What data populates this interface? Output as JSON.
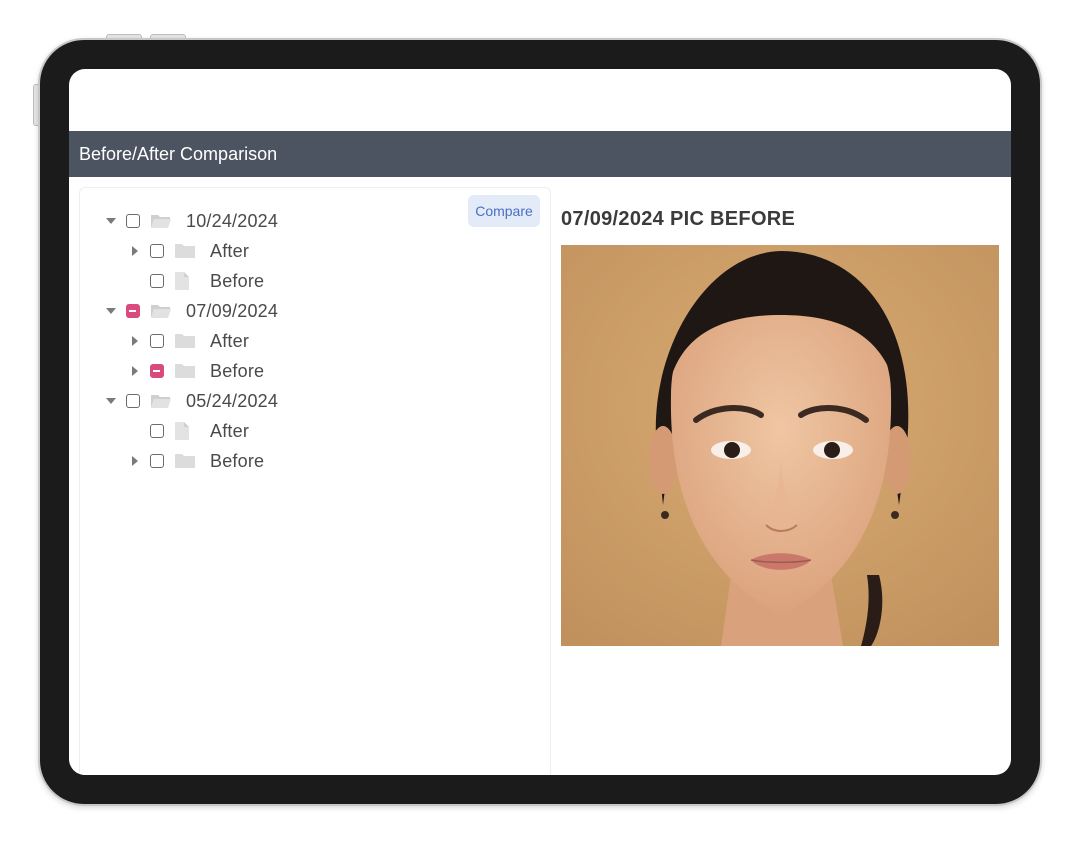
{
  "header": {
    "title": "Before/After Comparison"
  },
  "toolbar": {
    "compare_label": "Compare"
  },
  "tree": [
    {
      "label": "10/24/2024",
      "level": 0,
      "expanded": true,
      "checkbox": "unchecked",
      "icon": "folder-open-icon"
    },
    {
      "label": "After",
      "level": 1,
      "expanded": false,
      "checkbox": "unchecked",
      "icon": "folder-icon"
    },
    {
      "label": "Before",
      "level": 1,
      "leaf": true,
      "checkbox": "unchecked",
      "icon": "file-icon"
    },
    {
      "label": "07/09/2024",
      "level": 0,
      "expanded": true,
      "checkbox": "indeterminate",
      "icon": "folder-open-icon"
    },
    {
      "label": "After",
      "level": 1,
      "expanded": false,
      "checkbox": "unchecked",
      "icon": "folder-icon"
    },
    {
      "label": "Before",
      "level": 1,
      "expanded": false,
      "checkbox": "indeterminate",
      "icon": "folder-icon"
    },
    {
      "label": "05/24/2024",
      "level": 0,
      "expanded": true,
      "checkbox": "unchecked",
      "icon": "folder-open-icon"
    },
    {
      "label": "After",
      "level": 1,
      "leaf": true,
      "checkbox": "unchecked",
      "icon": "file-icon"
    },
    {
      "label": "Before",
      "level": 1,
      "expanded": false,
      "checkbox": "unchecked",
      "icon": "folder-icon"
    }
  ],
  "preview": {
    "title": "07/09/2024 PIC BEFORE"
  },
  "colors": {
    "titlebar": "#4d5461",
    "accent": "#d94b7f",
    "compare_bg": "#e3ebf9",
    "compare_text": "#4a6fc4"
  }
}
